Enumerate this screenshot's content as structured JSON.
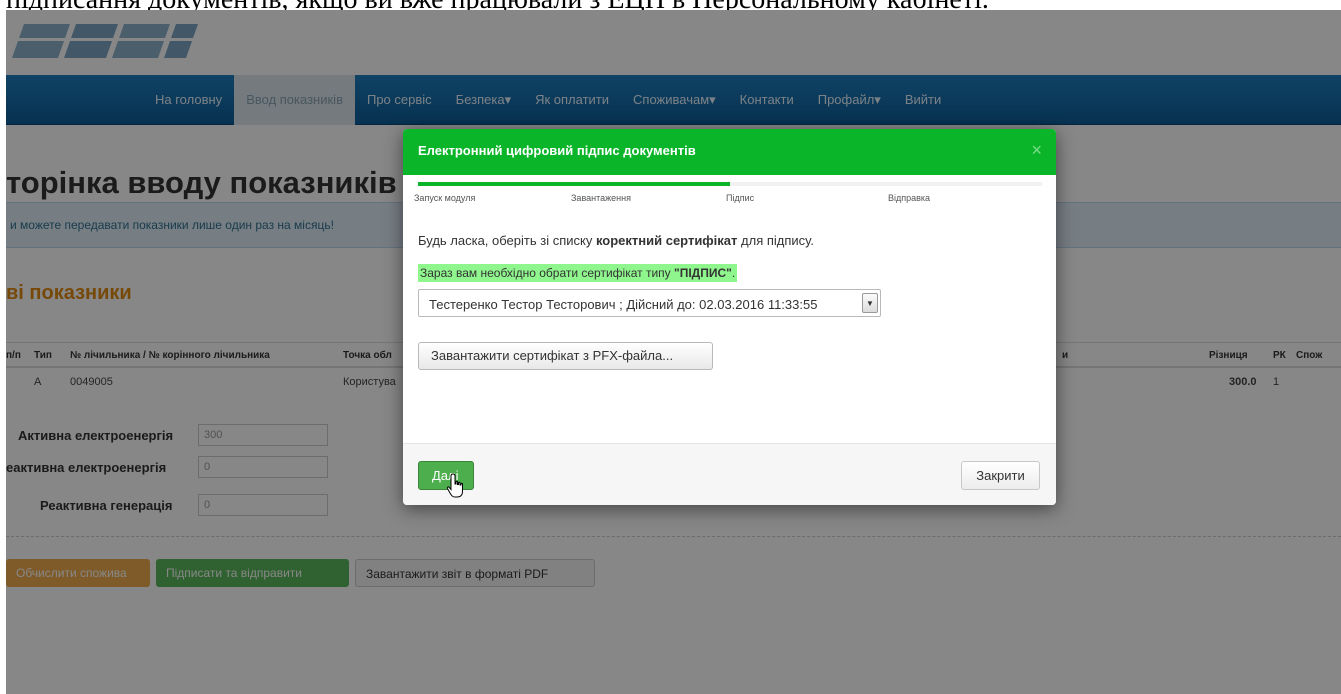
{
  "caption": {
    "text": "підписання документів, якщо ви вже працювали з ЕЦП в Персональному кабінеті."
  },
  "nav": {
    "items": [
      "На головну",
      "Ввод показників",
      "Про сервіс",
      "Безпека▾",
      "Як оплатити",
      "Споживачам▾",
      "Контакти",
      "Профайл▾",
      "Вийти"
    ],
    "active_index": 1
  },
  "page": {
    "title": "торінка вводу показників",
    "info": "и можете передавати показники лише один раз на місяць!",
    "section_title": "ві показники",
    "table": {
      "headers": [
        "п/п",
        "Тип",
        "№ лічильника / № корінного лічильника",
        "Точка обл",
        "и",
        "Різниця",
        "РК",
        "Спож"
      ],
      "row": [
        "А",
        "0049005",
        "Користува",
        "300.0",
        "1"
      ]
    },
    "form": {
      "active_label": "Активна електроенергія",
      "active_value": "300",
      "reactive_label": "еактивна електроенергія",
      "reactive_value": "0",
      "generation_label": "Реактивна генерація",
      "generation_value": "0"
    },
    "buttons": {
      "calc": "Обчислити спожива",
      "sign_send": "Підписати та відправити",
      "pdf": "Завантажити звіт в форматі PDF"
    }
  },
  "modal": {
    "title": "Електронний цифровий підпис документів",
    "close_symbol": "×",
    "progress_fraction": 0.5,
    "steps": [
      "Запуск модуля",
      "Завантаження",
      "Підпис",
      "Відправка"
    ],
    "instruction_prefix": "Будь ласка, оберіть зі списку ",
    "instruction_bold": "коректний сертифікат",
    "instruction_suffix": " для підпису.",
    "highlight_prefix": "Зараз вам необхідно обрати сертифікат типу ",
    "highlight_bold": "\"ПІДПИС\"",
    "highlight_suffix": ".",
    "certificate_selected": "Тестеренко Тестор Тесторович ; Дійсний до: 02.03.2016 11:33:55",
    "load_pfx_label": "Завантажити сертифікат з PFX-файла...",
    "next_label": "Далі",
    "close_label": "Закрити"
  },
  "colors": {
    "modal_header": "#0bb52a",
    "navbar": "#1470ad",
    "highlight": "#8ff58d",
    "section_title": "#e08a12",
    "next_button": "#4cae4c"
  },
  "icons": [
    "logo-icon",
    "close-icon",
    "chevron-down-icon",
    "hand-cursor-icon"
  ]
}
